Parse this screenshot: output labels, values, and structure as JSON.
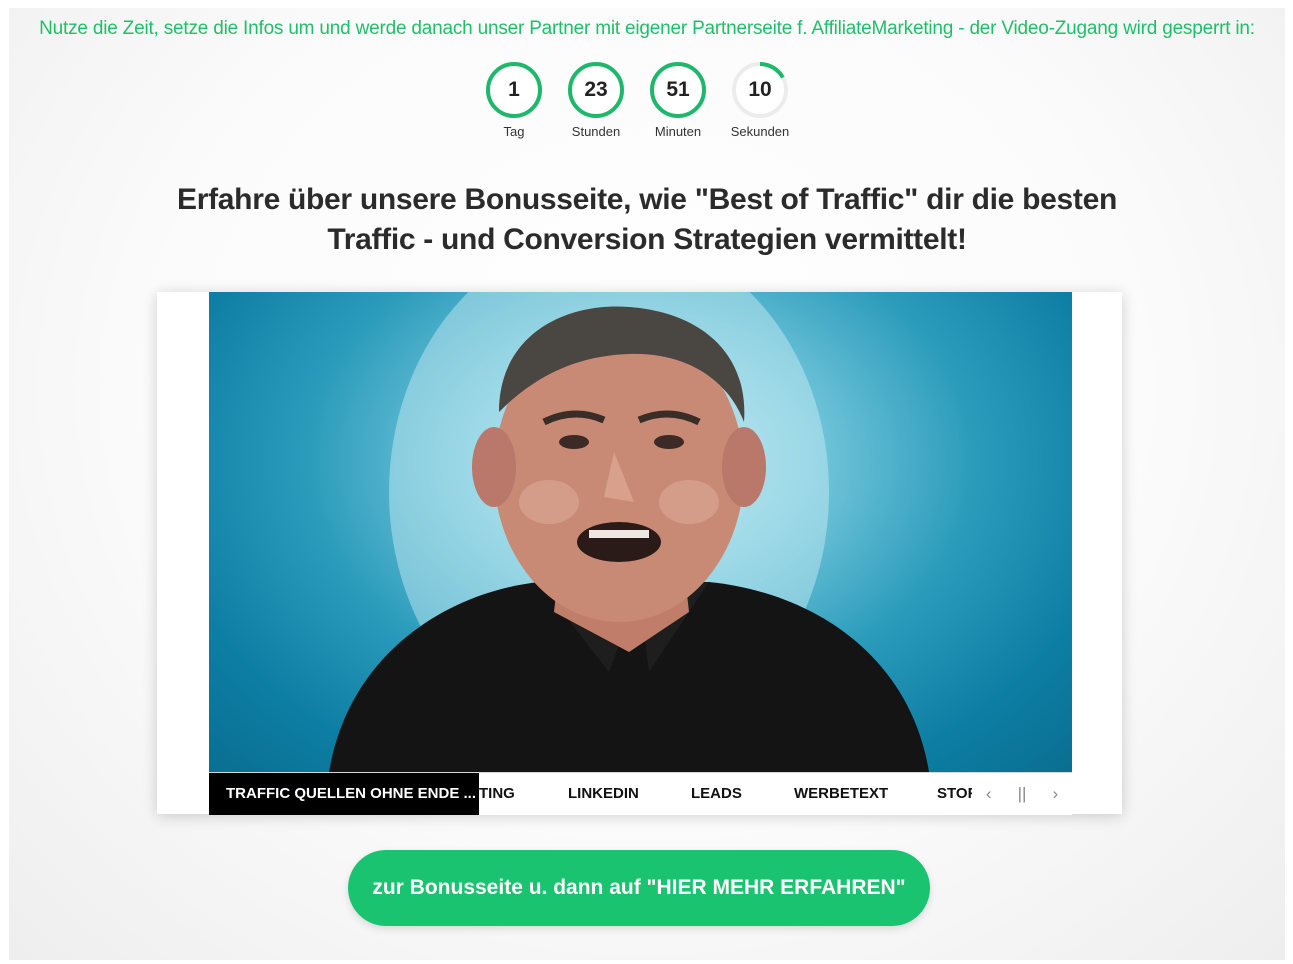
{
  "notice": "Nutze die Zeit, setze die Infos um und werde danach unser Partner mit eigener Partnerseite f. AffiliateMarketing - der Video-Zugang wird gesperrt in:",
  "countdown": [
    {
      "value": "1",
      "label": "Tag",
      "progress": 1.0
    },
    {
      "value": "23",
      "label": "Stunden",
      "progress": 1.0
    },
    {
      "value": "51",
      "label": "Minuten",
      "progress": 1.0
    },
    {
      "value": "10",
      "label": "Sekunden",
      "progress": 0.17
    }
  ],
  "headline": {
    "line1": "Erfahre über unsere Bonusseite, wie \"Best of Traffic\" dir die besten",
    "line2": "Traffic - und Conversion Strategien vermittelt!"
  },
  "video": {
    "chapters_active": "TRAFFIC QUELLEN OHNE ENDE ...",
    "chapters": [
      "TING",
      "LINKEDIN",
      "LEADS",
      "WERBETEXT",
      "STOR"
    ],
    "controls": {
      "prev": "‹",
      "pause": "||",
      "next": "›"
    }
  },
  "cta_label": "zur Bonusseite u. dann auf \"HIER MEHR ERFAHREN\"",
  "colors": {
    "accent": "#1fbf6a",
    "button": "#19c36f",
    "ring": "#1db86a"
  }
}
